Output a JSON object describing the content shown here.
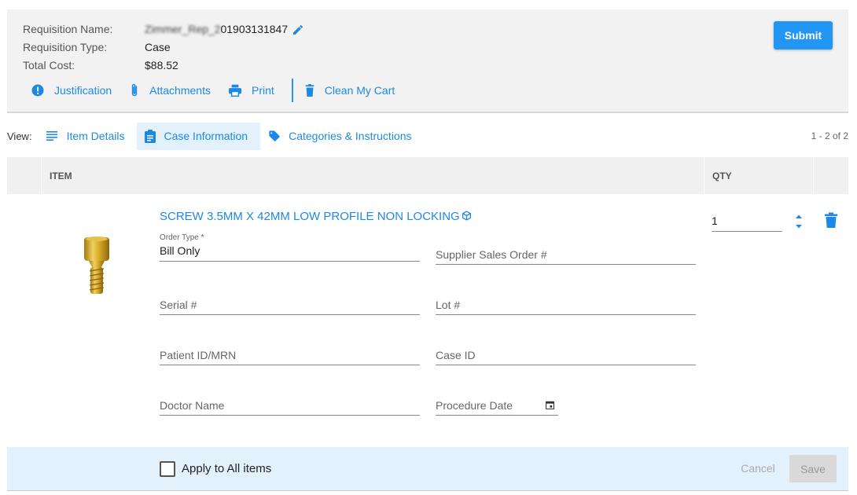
{
  "requisition": {
    "name_label": "Requisition Name:",
    "name_blurred": "Zimmer_Rep_2",
    "name_visible": "01903131847",
    "type_label": "Requisition Type:",
    "type_value": "Case",
    "cost_label": "Total Cost:",
    "cost_value": "$88.52"
  },
  "header": {
    "submit_label": "Submit",
    "actions": {
      "justification": "Justification",
      "attachments": "Attachments",
      "print": "Print",
      "clean_cart": "Clean My Cart"
    }
  },
  "views": {
    "label": "View:",
    "tabs": [
      "Item Details",
      "Case Information",
      "Categories & Instructions"
    ],
    "active": "Case Information",
    "pager": "1 - 2 of 2"
  },
  "table": {
    "headers": {
      "item": "ITEM",
      "qty": "QTY"
    }
  },
  "item": {
    "title": "SCREW 3.5MM X 42MM LOW PROFILE NON LOCKING",
    "quantity": "1",
    "fields": {
      "order_type_label": "Order Type *",
      "order_type_value": "Bill Only",
      "supplier_sales_order": "Supplier Sales Order #",
      "serial": "Serial #",
      "lot": "Lot #",
      "patient_id": "Patient ID/MRN",
      "case_id": "Case ID",
      "doctor_name": "Doctor Name",
      "procedure_date": "Procedure Date"
    }
  },
  "footer": {
    "apply_all_label": "Apply to All items",
    "cancel_label": "Cancel",
    "save_label": "Save"
  },
  "colors": {
    "accent": "#2196f3",
    "link": "#1e88e5",
    "active_tab_bg": "#e3f1fd",
    "header_bg": "#f2f2f2"
  },
  "icons": [
    "edit-icon",
    "info-icon",
    "paperclip-icon",
    "printer-icon",
    "trash-icon",
    "list-icon",
    "clipboard-icon",
    "tag-icon",
    "box-icon",
    "stepper-icon",
    "calendar-icon",
    "checkbox-icon"
  ]
}
